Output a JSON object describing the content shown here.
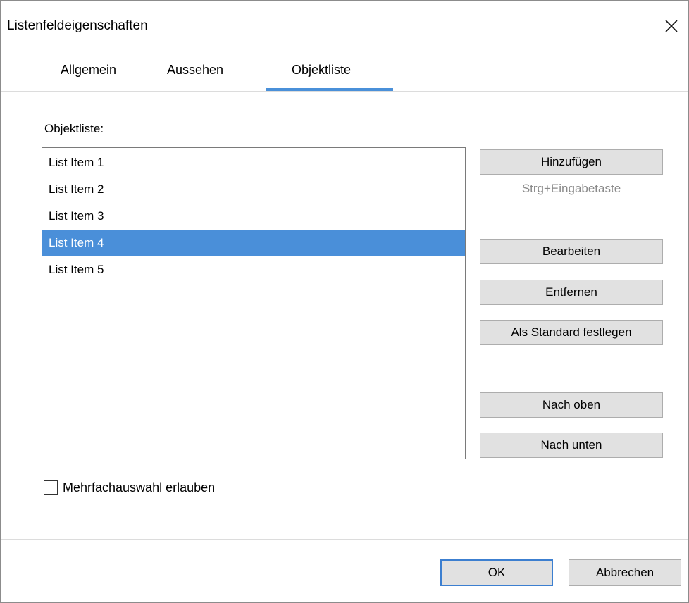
{
  "window": {
    "title": "Listenfeldeigenschaften",
    "close_icon": "close-icon"
  },
  "tabs": [
    {
      "label": "Allgemein",
      "active": false
    },
    {
      "label": "Aussehen",
      "active": false
    },
    {
      "label": "Objektliste",
      "active": true
    }
  ],
  "colors": {
    "accent": "#4a90d9",
    "selection": "#4a8fd9",
    "button_face": "#e1e1e1",
    "hint_text": "#8a8a8a"
  },
  "objektliste": {
    "label": "Objektliste:",
    "items": [
      {
        "label": "List Item 1",
        "selected": false
      },
      {
        "label": "List Item 2",
        "selected": false
      },
      {
        "label": "List Item 3",
        "selected": false
      },
      {
        "label": "List Item 4",
        "selected": true
      },
      {
        "label": "List Item 5",
        "selected": false
      }
    ]
  },
  "buttons": {
    "add": "Hinzufügen",
    "add_hint": "Strg+Eingabetaste",
    "edit": "Bearbeiten",
    "remove": "Entfernen",
    "set_default": "Als Standard festlegen",
    "move_up": "Nach oben",
    "move_down": "Nach unten"
  },
  "multiselect": {
    "label": "Mehrfachauswahl erlauben",
    "checked": false
  },
  "footer": {
    "ok": "OK",
    "cancel": "Abbrechen"
  }
}
